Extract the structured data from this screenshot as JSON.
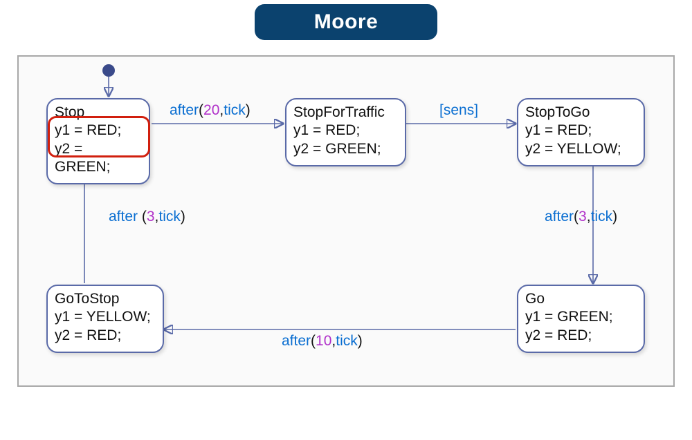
{
  "title": "Moore",
  "states": {
    "stop": {
      "name": "Stop",
      "y1": "y1 = RED;",
      "y2": "y2 = GREEN;"
    },
    "stopForTraffic": {
      "name": "StopForTraffic",
      "y1": "y1 = RED;",
      "y2": "y2 = GREEN;"
    },
    "stopToGo": {
      "name": "StopToGo",
      "y1": "y1 = RED;",
      "y2": "y2 = YELLOW;"
    },
    "go": {
      "name": "Go",
      "y1": "y1 = GREEN;",
      "y2": "y2 = RED;"
    },
    "goToStop": {
      "name": "GoToStop",
      "y1": "y1 = YELLOW;",
      "y2": "y2 = RED;"
    }
  },
  "transitions": {
    "stop_to_sft": {
      "kw": "after",
      "open": "(",
      "n": "20",
      "sep": ",",
      "ev": "tick",
      "close": ")"
    },
    "sft_to_stg": {
      "cond": "[sens]"
    },
    "stg_to_go": {
      "kw": "after",
      "open": "(",
      "n": "3",
      "sep": ",",
      "ev": "tick",
      "close": ")"
    },
    "go_to_gts": {
      "kw": "after",
      "open": "(",
      "n": "10",
      "sep": ",",
      "ev": "tick",
      "close": ")"
    },
    "gts_to_stop": {
      "kw": "after ",
      "open": "(",
      "n": "3",
      "sep": ",",
      "ev": "tick",
      "close": ")"
    }
  },
  "chart_data": {
    "type": "state-diagram",
    "semantics": "Moore",
    "initial_state": "Stop",
    "highlighted_state": "Stop",
    "states": [
      {
        "id": "Stop",
        "outputs": {
          "y1": "RED",
          "y2": "GREEN"
        }
      },
      {
        "id": "StopForTraffic",
        "outputs": {
          "y1": "RED",
          "y2": "GREEN"
        }
      },
      {
        "id": "StopToGo",
        "outputs": {
          "y1": "RED",
          "y2": "YELLOW"
        }
      },
      {
        "id": "Go",
        "outputs": {
          "y1": "GREEN",
          "y2": "RED"
        }
      },
      {
        "id": "GoToStop",
        "outputs": {
          "y1": "YELLOW",
          "y2": "RED"
        }
      }
    ],
    "transitions": [
      {
        "from": "Stop",
        "to": "StopForTraffic",
        "label": "after(20,tick)"
      },
      {
        "from": "StopForTraffic",
        "to": "StopToGo",
        "label": "[sens]"
      },
      {
        "from": "StopToGo",
        "to": "Go",
        "label": "after(3,tick)"
      },
      {
        "from": "Go",
        "to": "GoToStop",
        "label": "after(10,tick)"
      },
      {
        "from": "GoToStop",
        "to": "Stop",
        "label": "after (3,tick)"
      }
    ]
  }
}
